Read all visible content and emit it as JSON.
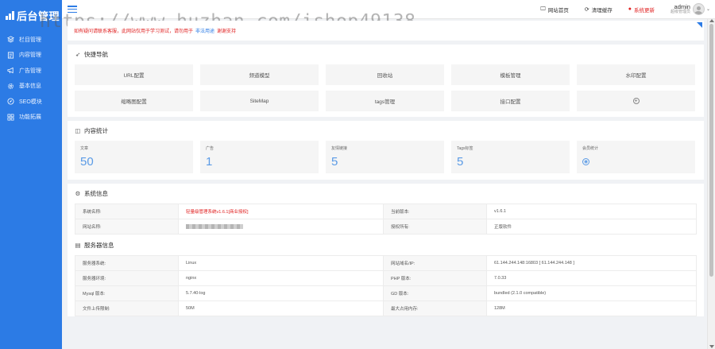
{
  "app": {
    "title": "后台管理",
    "watermark": "https://www.huzhan.com/ishop49138"
  },
  "sidebar": {
    "items": [
      {
        "label": "栏目管理",
        "icon": "layers-icon"
      },
      {
        "label": "内容管理",
        "icon": "document-icon"
      },
      {
        "label": "广告管理",
        "icon": "megaphone-icon"
      },
      {
        "label": "基本信息",
        "icon": "gear-icon"
      },
      {
        "label": "SEO模块",
        "icon": "compass-icon"
      },
      {
        "label": "功能拓展",
        "icon": "grid-icon"
      }
    ]
  },
  "topbar": {
    "site_home": "网站首页",
    "clear_cache": "清理缓存",
    "system_update": "系统更新",
    "username": "admin",
    "role": "超级管理员"
  },
  "notice": {
    "text": "如有疑问请联系客服，此网站仅用于学习测试，请勿用于",
    "highlight": "非法用途",
    "tail": "谢谢支持"
  },
  "quick_nav": {
    "title": "快捷导航",
    "items": [
      "URL配置",
      "频道模型",
      "回收站",
      "模板管理",
      "水印配置",
      "缩略图配置",
      "SiteMap",
      "tags管理",
      "接口配置"
    ]
  },
  "content_stats": {
    "title": "内容统计",
    "items": [
      {
        "label": "文章",
        "value": "50"
      },
      {
        "label": "广告",
        "value": "1"
      },
      {
        "label": "友情链接",
        "value": "5"
      },
      {
        "label": "Tags标签",
        "value": "5"
      },
      {
        "label": "会员统计",
        "value": ""
      }
    ]
  },
  "system_info": {
    "title": "系统信息",
    "rows": [
      {
        "k1": "系统名称:",
        "v1": "轻量级管理系统v1.6.1[商业授权]",
        "k2": "当前版本:",
        "v2": "v1.6.1"
      },
      {
        "k1": "网站名称:",
        "v1": "",
        "k2": "授权所有:",
        "v2": "正版软件"
      }
    ]
  },
  "server_info": {
    "title": "服务器信息",
    "rows": [
      {
        "k1": "服务器系统:",
        "v1": "Linux",
        "k2": "网站域名/IP:",
        "v2": "61.144.244.148:16803 [ 61.144.244.148 ]"
      },
      {
        "k1": "服务器环境:",
        "v1": "nginx",
        "k2": "PHP 版本:",
        "v2": "7.0.33"
      },
      {
        "k1": "Mysql 版本:",
        "v1": "5.7.40-log",
        "k2": "GD 版本:",
        "v2": "bundled (2.1.0 compatible)"
      },
      {
        "k1": "文件上传限制:",
        "v1": "50M",
        "k2": "最大占用内存:",
        "v2": "128M"
      }
    ]
  }
}
